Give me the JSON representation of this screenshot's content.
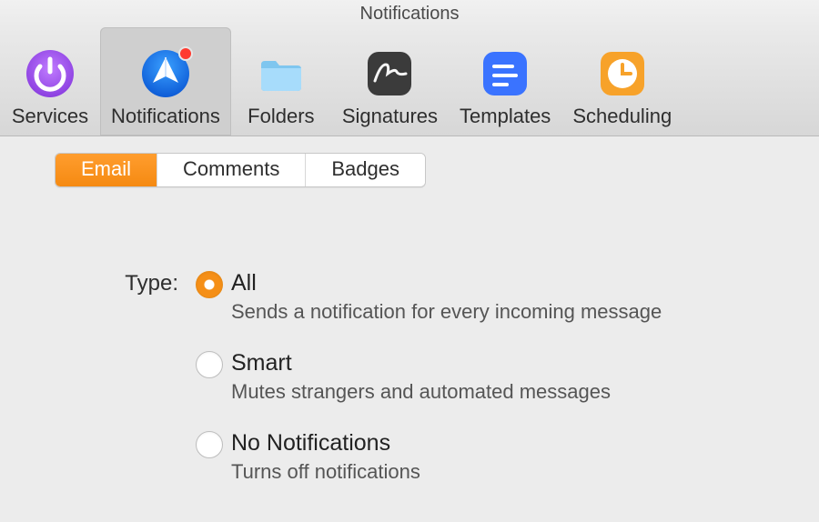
{
  "window": {
    "title": "Notifications"
  },
  "toolbar": {
    "items": [
      {
        "id": "services",
        "label": "Services"
      },
      {
        "id": "notifications",
        "label": "Notifications",
        "selected": true
      },
      {
        "id": "folders",
        "label": "Folders"
      },
      {
        "id": "signatures",
        "label": "Signatures"
      },
      {
        "id": "templates",
        "label": "Templates"
      },
      {
        "id": "scheduling",
        "label": "Scheduling"
      }
    ]
  },
  "subtabs": {
    "items": [
      {
        "id": "email",
        "label": "Email",
        "active": true
      },
      {
        "id": "comments",
        "label": "Comments",
        "active": false
      },
      {
        "id": "badges",
        "label": "Badges",
        "active": false
      }
    ]
  },
  "type_section": {
    "label": "Type:",
    "options": [
      {
        "id": "all",
        "title": "All",
        "subtitle": "Sends a notification for every incoming message",
        "checked": true
      },
      {
        "id": "smart",
        "title": "Smart",
        "subtitle": "Mutes strangers and automated messages",
        "checked": false
      },
      {
        "id": "none",
        "title": "No Notifications",
        "subtitle": "Turns off notifications",
        "checked": false
      }
    ]
  },
  "colors": {
    "accent": "#f58f17"
  }
}
